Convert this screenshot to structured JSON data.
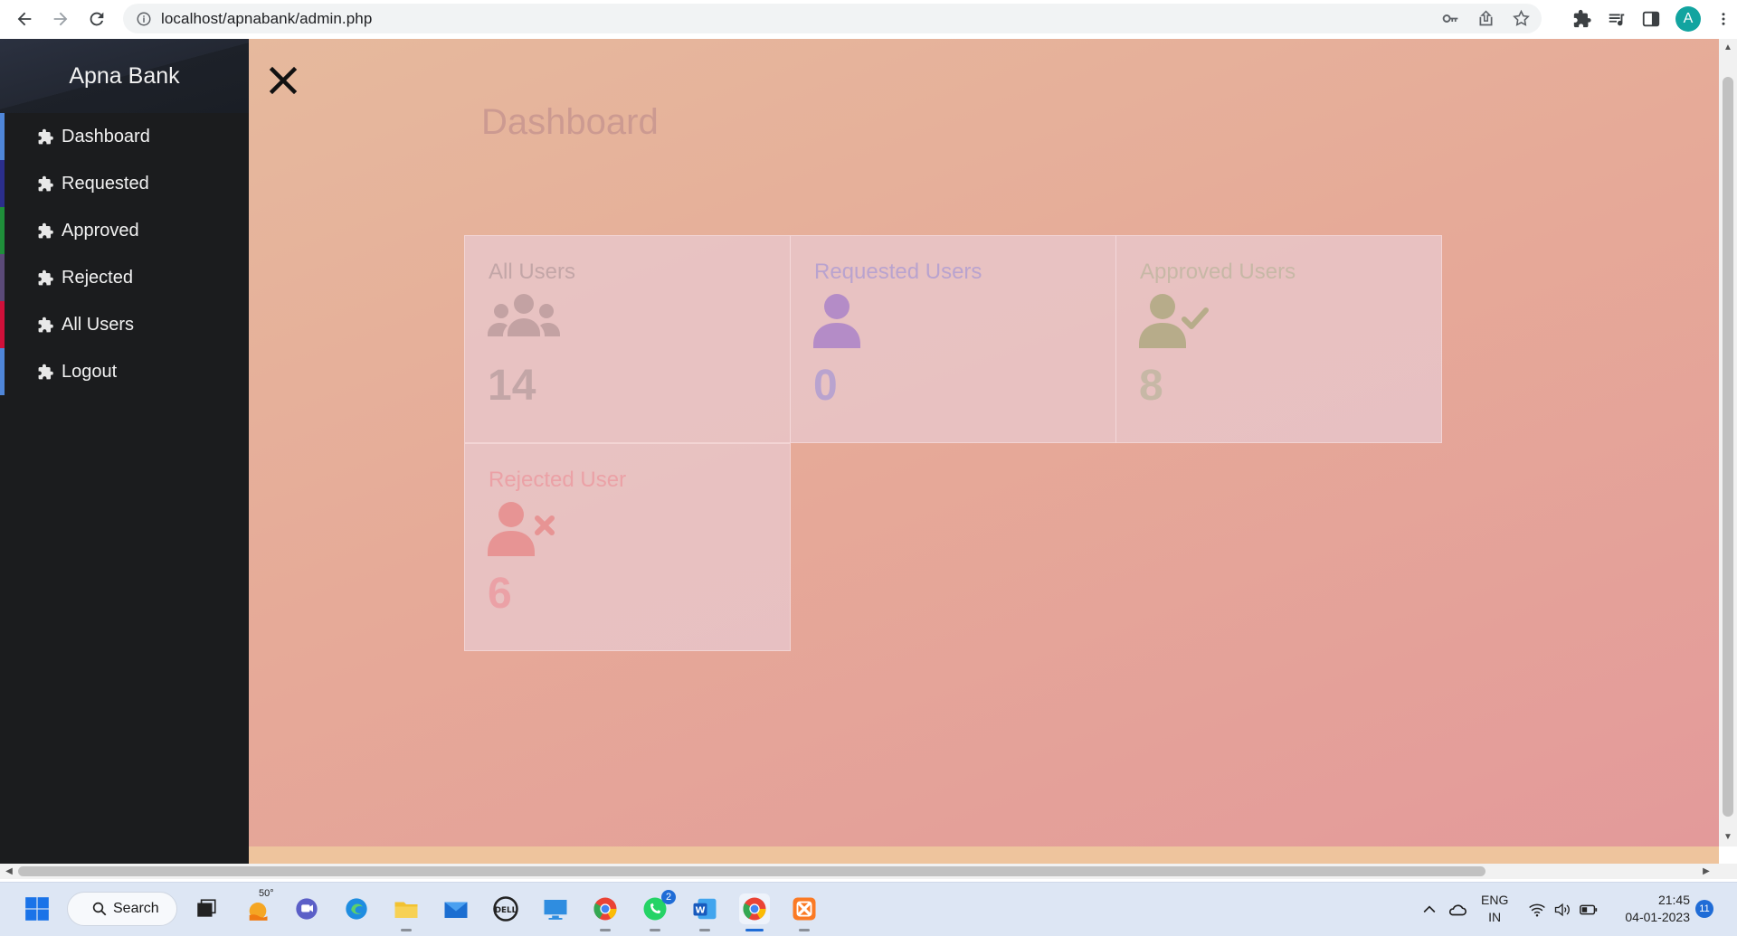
{
  "browser": {
    "url": "localhost/apnabank/admin.php",
    "profile_initial": "A"
  },
  "sidebar": {
    "brand": "Apna Bank",
    "items": [
      {
        "label": "Dashboard",
        "accent": "#4f86d9"
      },
      {
        "label": "Requested",
        "accent": "#2b2e8c"
      },
      {
        "label": "Approved",
        "accent": "#1f8f3a"
      },
      {
        "label": "Rejected",
        "accent": "#5b4a78"
      },
      {
        "label": "All Users",
        "accent": "#d0103a"
      },
      {
        "label": "Logout",
        "accent": "#4f86d9"
      }
    ]
  },
  "main": {
    "title": "Dashboard",
    "cards": [
      {
        "title": "All Users",
        "value": "14",
        "icon": "users-icon"
      },
      {
        "title": "Requested Users",
        "value": "0",
        "icon": "user-icon"
      },
      {
        "title": "Approved Users",
        "value": "8",
        "icon": "user-check-icon"
      },
      {
        "title": "Rejected User",
        "value": "6",
        "icon": "user-times-icon"
      }
    ]
  },
  "taskbar": {
    "search_label": "Search",
    "weather": "50°",
    "whatsapp_badge": "2",
    "lang_line1": "ENG",
    "lang_line2": "IN",
    "time": "21:45",
    "date": "04-01-2023",
    "notifications": "11"
  }
}
